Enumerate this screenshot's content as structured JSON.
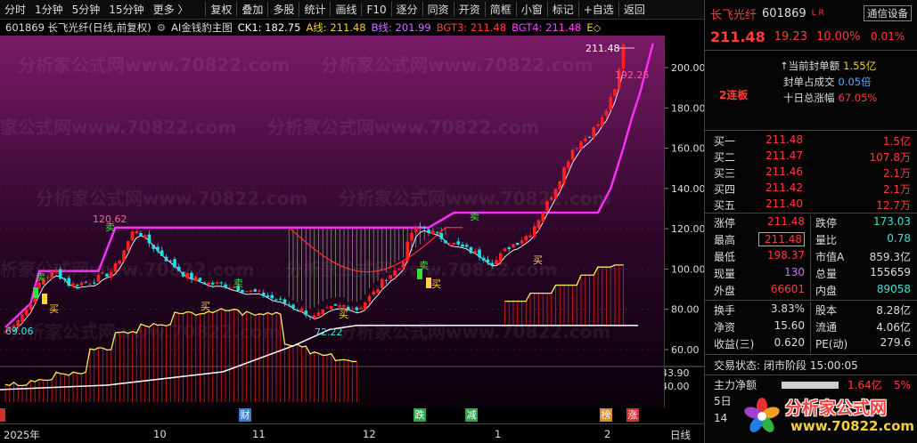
{
  "toolbar": {
    "left_items": [
      "分时",
      "1分钟",
      "5分钟",
      "15分钟",
      "更多 〉"
    ],
    "right_items": [
      "复权",
      "叠加",
      "多股",
      "统计",
      "画线",
      "F10",
      "逐分",
      "同资",
      "开资",
      "简框",
      "小窗",
      "标记",
      "+自选",
      "返回"
    ]
  },
  "chartbar": {
    "symbol": "601869 长飞光纤(日线,前复权)",
    "indicator": "AI金钱豹主图",
    "ck1": "CK1: 182.75",
    "a_line": "A线: 211.48",
    "b_line": "B线: 201.99",
    "bgt3": "BGT3: 211.48",
    "bgt4": "BGT4: 211.48",
    "tail": "E◇",
    "settings_icon": "gear-icon"
  },
  "chart": {
    "watermark": "分析家公式网www.70822.com",
    "labels": {
      "high": "211.48",
      "close_mark": "192.25",
      "peak1": "120.62",
      "low1": "69.06",
      "low2": "72.22",
      "buy": "买",
      "sell": "卖"
    },
    "price_ticks": [
      "200.00",
      "180.00",
      "160.00",
      "140.00",
      "120.00",
      "100.00",
      "80.00",
      "60.00"
    ],
    "vol_ticks": [
      "43.90",
      "40.00"
    ],
    "time_labels": [
      "2025年",
      "10",
      "11",
      "12",
      "1",
      "2",
      "日线"
    ],
    "events": [
      {
        "text": "财",
        "color": "#3a7bd5"
      },
      {
        "text": "跌",
        "color": "#2aa84a"
      },
      {
        "text": "减",
        "color": "#2aa84a"
      },
      {
        "text": "榜",
        "color": "#e08a20"
      },
      {
        "text": "涨",
        "color": "#d03030"
      }
    ],
    "colors": {
      "up": "#ff2020",
      "down": "#20e0e0",
      "envelope": "#ff30ff",
      "cloud": "#ff3030",
      "base": "#ffffff",
      "yellow": "#f0f060"
    }
  },
  "quote": {
    "name": "长飞光纤",
    "code": "601869",
    "badges": "L R",
    "device_label": "通信设备",
    "price": "211.48",
    "change": "19.23",
    "change_pct": "10.00%",
    "device_pct": "0.01%",
    "seal_amount_label": "↑当前封单额",
    "seal_amount": "1.55亿",
    "seal_ratio_label": "封单占成交",
    "seal_ratio": "0.05倍",
    "ten_day_label": "十日总涨幅",
    "ten_day": "67.05%",
    "board_tag": "2连板"
  },
  "orderbook": [
    {
      "name": "买一",
      "price": "211.48",
      "vol": "1.5亿"
    },
    {
      "name": "买二",
      "price": "211.47",
      "vol": "107.8万"
    },
    {
      "name": "买三",
      "price": "211.46",
      "vol": "2.1万"
    },
    {
      "name": "买四",
      "price": "211.42",
      "vol": "2.1万"
    },
    {
      "name": "买五",
      "price": "211.40",
      "vol": "12.7万"
    }
  ],
  "stats": [
    {
      "l1": "涨停",
      "v1": "211.48",
      "c1": "red",
      "l2": "跌停",
      "v2": "173.03",
      "c2": "green"
    },
    {
      "l1": "最高",
      "v1": "211.48",
      "c1": "red",
      "l2": "量比",
      "v2": "0.78",
      "c2": "green"
    },
    {
      "l1": "最低",
      "v1": "198.37",
      "c1": "red",
      "l2": "市值A",
      "v2": "859.3亿",
      "c2": ""
    },
    {
      "l1": "现量",
      "v1": "130",
      "c1": "purple",
      "l2": "总量",
      "v2": "155659",
      "c2": ""
    },
    {
      "l1": "外盘",
      "v1": "66601",
      "c1": "red",
      "l2": "内盘",
      "v2": "89058",
      "c2": "green"
    }
  ],
  "stats2": [
    {
      "l1": "换手",
      "v1": "3.83%",
      "l2": "股本",
      "v2": "8.28亿"
    },
    {
      "l1": "净资",
      "v1": "15.60",
      "l2": "流通",
      "v2": "4.06亿"
    },
    {
      "l1": "收益(三)",
      "v1": "0.620",
      "l2": "PE(动)",
      "v2": "279.6"
    }
  ],
  "status": {
    "label": "交易状态:",
    "value": "闭市阶段 15:00:05"
  },
  "net": {
    "label": "主力净额",
    "value": "1.64亿",
    "pct": "5%"
  },
  "footer": {
    "day": "5日",
    "time": "14",
    "site": "分析家公式网",
    "url": "www.70822.com"
  }
}
